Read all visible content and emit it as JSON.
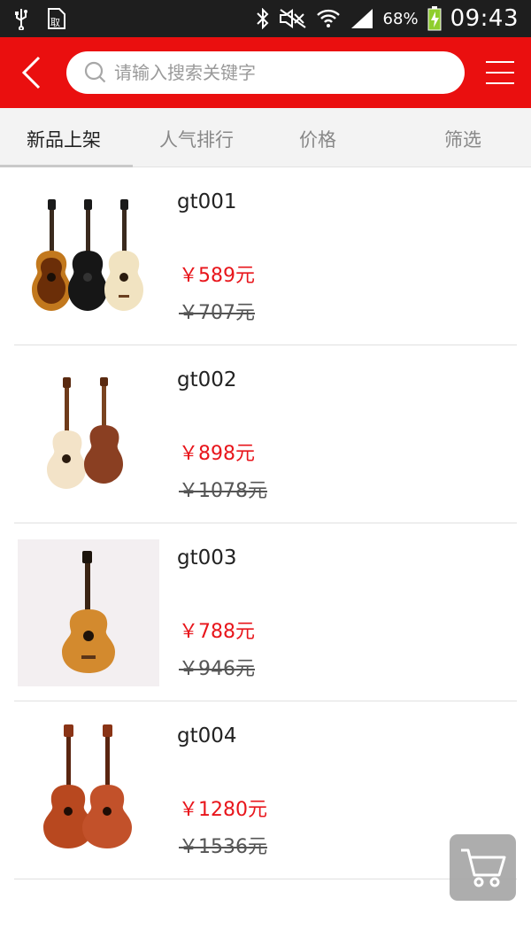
{
  "status_bar": {
    "battery": "68%",
    "time": "09:43",
    "icons": [
      "usb-icon",
      "notification-icon",
      "bluetooth-icon",
      "mute-icon",
      "wifi-icon",
      "signal-icon",
      "battery-icon"
    ]
  },
  "header": {
    "search_placeholder": "请输入搜索关键字",
    "accent_color": "#ea0f0f"
  },
  "tabs": [
    {
      "label": "新品上架",
      "active": true
    },
    {
      "label": "人气排行",
      "active": false
    },
    {
      "label": "价格",
      "active": false
    },
    {
      "label": "筛选",
      "active": false
    }
  ],
  "products": [
    {
      "name": "gt001",
      "price": "￥589元",
      "old_price": "￥707元",
      "image": "three-guitars"
    },
    {
      "name": "gt002",
      "price": "￥898元",
      "old_price": "￥1078元",
      "image": "two-guitars-front-back"
    },
    {
      "name": "gt003",
      "price": "￥788元",
      "old_price": "￥946元",
      "image": "single-guitar"
    },
    {
      "name": "gt004",
      "price": "￥1280元",
      "old_price": "￥1536元",
      "image": "two-red-guitars"
    }
  ],
  "cart": {
    "icon": "cart-icon"
  }
}
